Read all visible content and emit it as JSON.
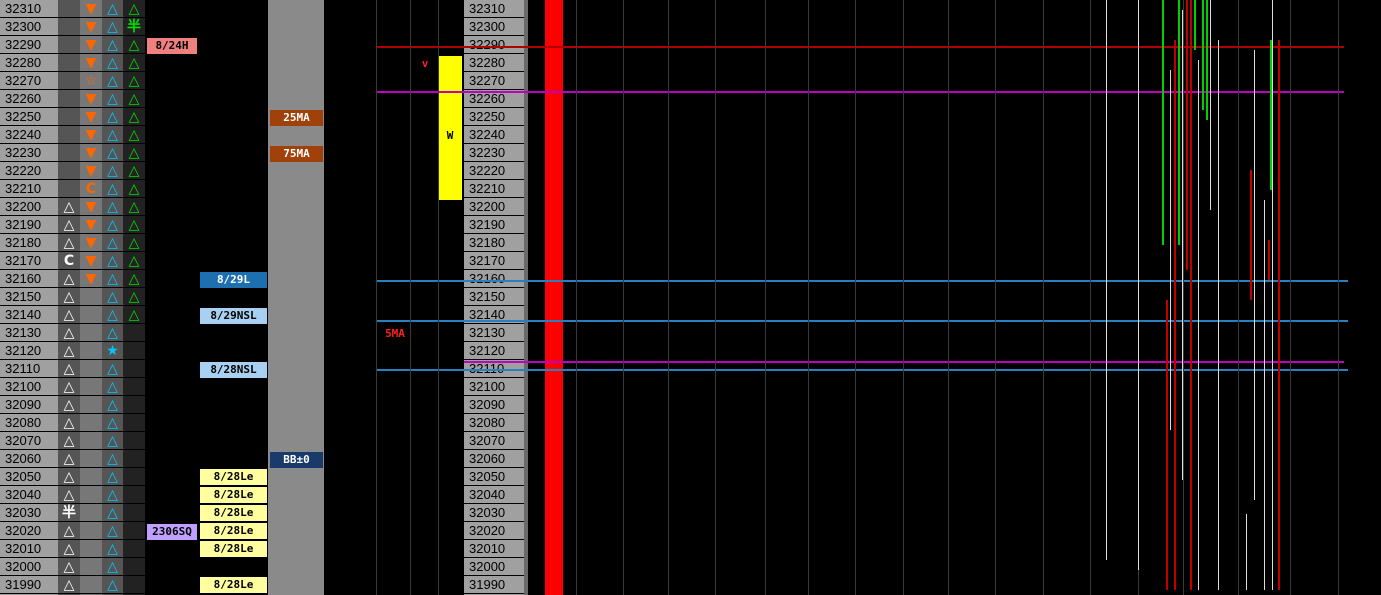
{
  "prices": [
    "32310",
    "32300",
    "32290",
    "32280",
    "32270",
    "32260",
    "32250",
    "32240",
    "32230",
    "32220",
    "32210",
    "32200",
    "32190",
    "32180",
    "32170",
    "32160",
    "32150",
    "32140",
    "32130",
    "32120",
    "32110",
    "32100",
    "32090",
    "32080",
    "32070",
    "32060",
    "32050",
    "32040",
    "32030",
    "32020",
    "32010",
    "32000",
    "31990"
  ],
  "col_a": [
    "",
    "",
    "",
    "",
    "",
    "",
    "",
    "",
    "",
    "",
    "",
    "△",
    "△",
    "△",
    "C",
    "△",
    "△",
    "△",
    "△",
    "△",
    "△",
    "△",
    "△",
    "△",
    "△",
    "△",
    "△",
    "△",
    "半",
    "△",
    "△",
    "△",
    "△"
  ],
  "col_b": [
    "▼",
    "▼",
    "▼",
    "▼",
    "☆",
    "▼",
    "▼",
    "▼",
    "▼",
    "▼",
    "C",
    "▼",
    "▼",
    "▼",
    "▼",
    "▼",
    "",
    "",
    "",
    "",
    "",
    "",
    "",
    "",
    "",
    "",
    "",
    "",
    "",
    "",
    "",
    "",
    ""
  ],
  "col_c": [
    "△",
    "△",
    "△",
    "△",
    "△",
    "△",
    "△",
    "△",
    "△",
    "△",
    "△",
    "△",
    "△",
    "△",
    "△",
    "△",
    "△",
    "△",
    "△",
    "★",
    "△",
    "△",
    "△",
    "△",
    "△",
    "△",
    "△",
    "△",
    "△",
    "△",
    "△",
    "△",
    "△"
  ],
  "col_d": [
    "△",
    "半",
    "△",
    "△",
    "△",
    "△",
    "△",
    "△",
    "△",
    "△",
    "△",
    "△",
    "△",
    "△",
    "△",
    "△",
    "△",
    "△",
    "",
    "",
    "",
    "",
    "",
    "",
    "",
    "",
    "",
    "",
    "",
    "",
    "",
    "",
    ""
  ],
  "tags": {
    "t824h": "8/24H",
    "t2306sq": "2306SQ",
    "t829l": "8/29L",
    "t829nsl": "8/29NSL",
    "t828nsl": "8/28NSL",
    "t828le": "8/28Le",
    "t25ma": "25MA",
    "t75ma": "75MA",
    "tbb": "BB±0",
    "t5ma": "5MA",
    "tv": "v",
    "tw": "W"
  },
  "colors": {
    "down_arrow": "#ff6600",
    "up_cyan": "#00c8ff",
    "up_green": "#00e000",
    "red_band": "#ff0000",
    "magenta_line": "#c000c0",
    "blue_line": "#2a7fbf",
    "dark_red_line": "#c00000",
    "yellow_box": "#ffff00"
  }
}
